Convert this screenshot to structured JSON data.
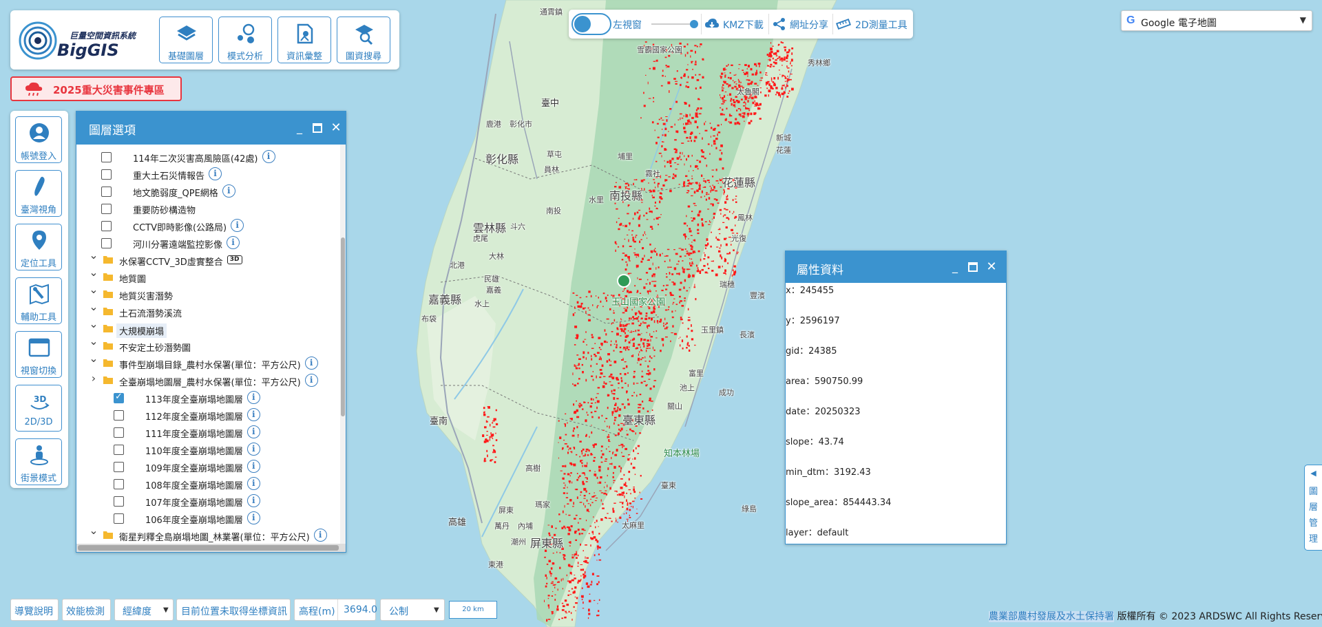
{
  "logo": {
    "subtitle": "巨量空間資訊系統",
    "title": "BigGIS"
  },
  "top_menu": [
    {
      "label": "基礎圖層",
      "icon": "layers-icon"
    },
    {
      "label": "模式分析",
      "icon": "analysis-icon"
    },
    {
      "label": "資訊彙整",
      "icon": "map-pin-icon"
    },
    {
      "label": "圖資搜尋",
      "icon": "search-icon"
    }
  ],
  "disaster_button": {
    "label": "2025重大災害事件專區",
    "icon": "cloud-rain-icon"
  },
  "left_tools": [
    {
      "label": "帳號登入",
      "icon": "user-icon"
    },
    {
      "label": "臺灣視角",
      "icon": "taiwan-icon"
    },
    {
      "label": "定位工具",
      "icon": "location-icon"
    },
    {
      "label": "輔助工具",
      "icon": "tools-icon"
    },
    {
      "label": "視窗切換",
      "icon": "window-icon"
    },
    {
      "label": "2D/3D",
      "icon": "rotate-3d-icon"
    },
    {
      "label": "街景模式",
      "icon": "street-view-icon"
    }
  ],
  "layer_panel": {
    "title": "圖層選項",
    "rows": [
      {
        "type": "check",
        "label": "114年二次災害高風險區(42處)",
        "checked": false,
        "info": true
      },
      {
        "type": "check",
        "label": "重大土石災情報告",
        "checked": false,
        "info": true
      },
      {
        "type": "check",
        "label": "地文脆弱度_QPE網格",
        "checked": false,
        "info": true
      },
      {
        "type": "check",
        "label": "重要防砂構造物",
        "checked": false,
        "info": false
      },
      {
        "type": "check",
        "label": "CCTV即時影像(公路局)",
        "checked": false,
        "info": true
      },
      {
        "type": "check",
        "label": "河川分署遠端監控影像",
        "checked": false,
        "info": true
      },
      {
        "type": "folder",
        "label": "水保署CCTV_3D虛實整合",
        "badge": "3D",
        "expanded": true
      },
      {
        "type": "folder",
        "label": "地質圖",
        "expanded": true
      },
      {
        "type": "folder",
        "label": "地質災害潛勢",
        "expanded": true
      },
      {
        "type": "folder",
        "label": "土石流潛勢溪流",
        "expanded": true
      },
      {
        "type": "folder",
        "label": "大規模崩塌",
        "expanded": true,
        "highlight": true
      },
      {
        "type": "folder",
        "label": "不安定土砂潛勢圖",
        "expanded": true
      },
      {
        "type": "folder",
        "label": "事件型崩塌目錄_農村水保署(單位：平方公尺)",
        "expanded": true,
        "info": true
      },
      {
        "type": "folder",
        "label": "全臺崩塌地圖層_農村水保署(單位：平方公尺)",
        "expanded": false,
        "info": true
      },
      {
        "type": "subcheck",
        "label": "113年度全臺崩塌地圖層",
        "checked": true,
        "info": true
      },
      {
        "type": "subcheck",
        "label": "112年度全臺崩塌地圖層",
        "checked": false,
        "info": true
      },
      {
        "type": "subcheck",
        "label": "111年度全臺崩塌地圖層",
        "checked": false,
        "info": true
      },
      {
        "type": "subcheck",
        "label": "110年度全臺崩塌地圖層",
        "checked": false,
        "info": true
      },
      {
        "type": "subcheck",
        "label": "109年度全臺崩塌地圖層",
        "checked": false,
        "info": true
      },
      {
        "type": "subcheck",
        "label": "108年度全臺崩塌地圖層",
        "checked": false,
        "info": true
      },
      {
        "type": "subcheck",
        "label": "107年度全臺崩塌地圖層",
        "checked": false,
        "info": true
      },
      {
        "type": "subcheck",
        "label": "106年度全臺崩塌地圖層",
        "checked": false,
        "info": true
      },
      {
        "type": "folder",
        "label": "衛星判釋全島崩塌地圖_林業署(單位：平方公尺)",
        "expanded": true,
        "info": true
      }
    ]
  },
  "top_toolbar": {
    "left_window": "左視窗",
    "kmz": "KMZ下載",
    "share": "網址分享",
    "measure": "2D測量工具"
  },
  "basemap": {
    "label": "Google 電子地圖",
    "g": "G"
  },
  "attributes": {
    "title": "屬性資料",
    "items": [
      "x：245455",
      "y：2596197",
      "gid：24385",
      "area：590750.99",
      "date：20250323",
      "slope：43.74",
      "min_dtm：3192.43",
      "slope_area：854443.34",
      "layer：default"
    ]
  },
  "side_tab": {
    "arrow": "◀",
    "chars": [
      "圖",
      "層",
      "管",
      "理"
    ]
  },
  "bottom": {
    "guide": "導覽說明",
    "perf": "效能檢測",
    "coord_type": "經緯度",
    "position": "目前位置未取得坐標資訊",
    "elev_label": "高程(m)",
    "elev_value": "3694.0",
    "unit": "公制",
    "scale": "20 km"
  },
  "copyright": {
    "link": "農業部農村發展及水土保持署",
    "text": "版權所有 © 2023 ARDSWC All Rights Reserved."
  },
  "map_labels": [
    {
      "t": "通霄鎮",
      "k": "small"
    },
    {
      "t": "雪霸國家公園",
      "k": "small"
    },
    {
      "t": "秀林鄉",
      "k": "small"
    },
    {
      "t": "臺中",
      "k": "city"
    },
    {
      "t": "太魯閣",
      "k": "small"
    },
    {
      "t": "鹿港",
      "k": "small"
    },
    {
      "t": "彰化市",
      "k": "small"
    },
    {
      "t": "彰化縣",
      "k": "county"
    },
    {
      "t": "草屯",
      "k": "small"
    },
    {
      "t": "埔里",
      "k": "small"
    },
    {
      "t": "新城",
      "k": "small"
    },
    {
      "t": "花蓮",
      "k": "small"
    },
    {
      "t": "員林",
      "k": "small"
    },
    {
      "t": "霧社",
      "k": "small"
    },
    {
      "t": "花蓮縣",
      "k": "county"
    },
    {
      "t": "南投縣",
      "k": "county"
    },
    {
      "t": "南投",
      "k": "small"
    },
    {
      "t": "水里",
      "k": "small"
    },
    {
      "t": "雲林縣",
      "k": "county"
    },
    {
      "t": "斗六",
      "k": "small"
    },
    {
      "t": "鳳林",
      "k": "small"
    },
    {
      "t": "虎尾",
      "k": "small"
    },
    {
      "t": "光復",
      "k": "small"
    },
    {
      "t": "北港",
      "k": "small"
    },
    {
      "t": "大林",
      "k": "small"
    },
    {
      "t": "民雄",
      "k": "small"
    },
    {
      "t": "嘉義",
      "k": "small"
    },
    {
      "t": "瑞穗",
      "k": "small"
    },
    {
      "t": "嘉義縣",
      "k": "county"
    },
    {
      "t": "玉山國家公園",
      "k": "park"
    },
    {
      "t": "豐濱",
      "k": "small"
    },
    {
      "t": "水上",
      "k": "small"
    },
    {
      "t": "布袋",
      "k": "small"
    },
    {
      "t": "玉里鎮",
      "k": "small"
    },
    {
      "t": "長濱",
      "k": "small"
    },
    {
      "t": "富里",
      "k": "small"
    },
    {
      "t": "池上",
      "k": "small"
    },
    {
      "t": "成功",
      "k": "small"
    },
    {
      "t": "臺南",
      "k": "city"
    },
    {
      "t": "關山",
      "k": "small"
    },
    {
      "t": "臺東縣",
      "k": "county"
    },
    {
      "t": "知本林場",
      "k": "park"
    },
    {
      "t": "高樹",
      "k": "small"
    },
    {
      "t": "臺東",
      "k": "small"
    },
    {
      "t": "屏東",
      "k": "small"
    },
    {
      "t": "綠島",
      "k": "small"
    },
    {
      "t": "高雄",
      "k": "city"
    },
    {
      "t": "瑪家",
      "k": "small"
    },
    {
      "t": "萬丹",
      "k": "small"
    },
    {
      "t": "太麻里",
      "k": "small"
    },
    {
      "t": "內埔",
      "k": "small"
    },
    {
      "t": "潮州",
      "k": "small"
    },
    {
      "t": "屏東縣",
      "k": "county"
    },
    {
      "t": "東港",
      "k": "small"
    }
  ]
}
